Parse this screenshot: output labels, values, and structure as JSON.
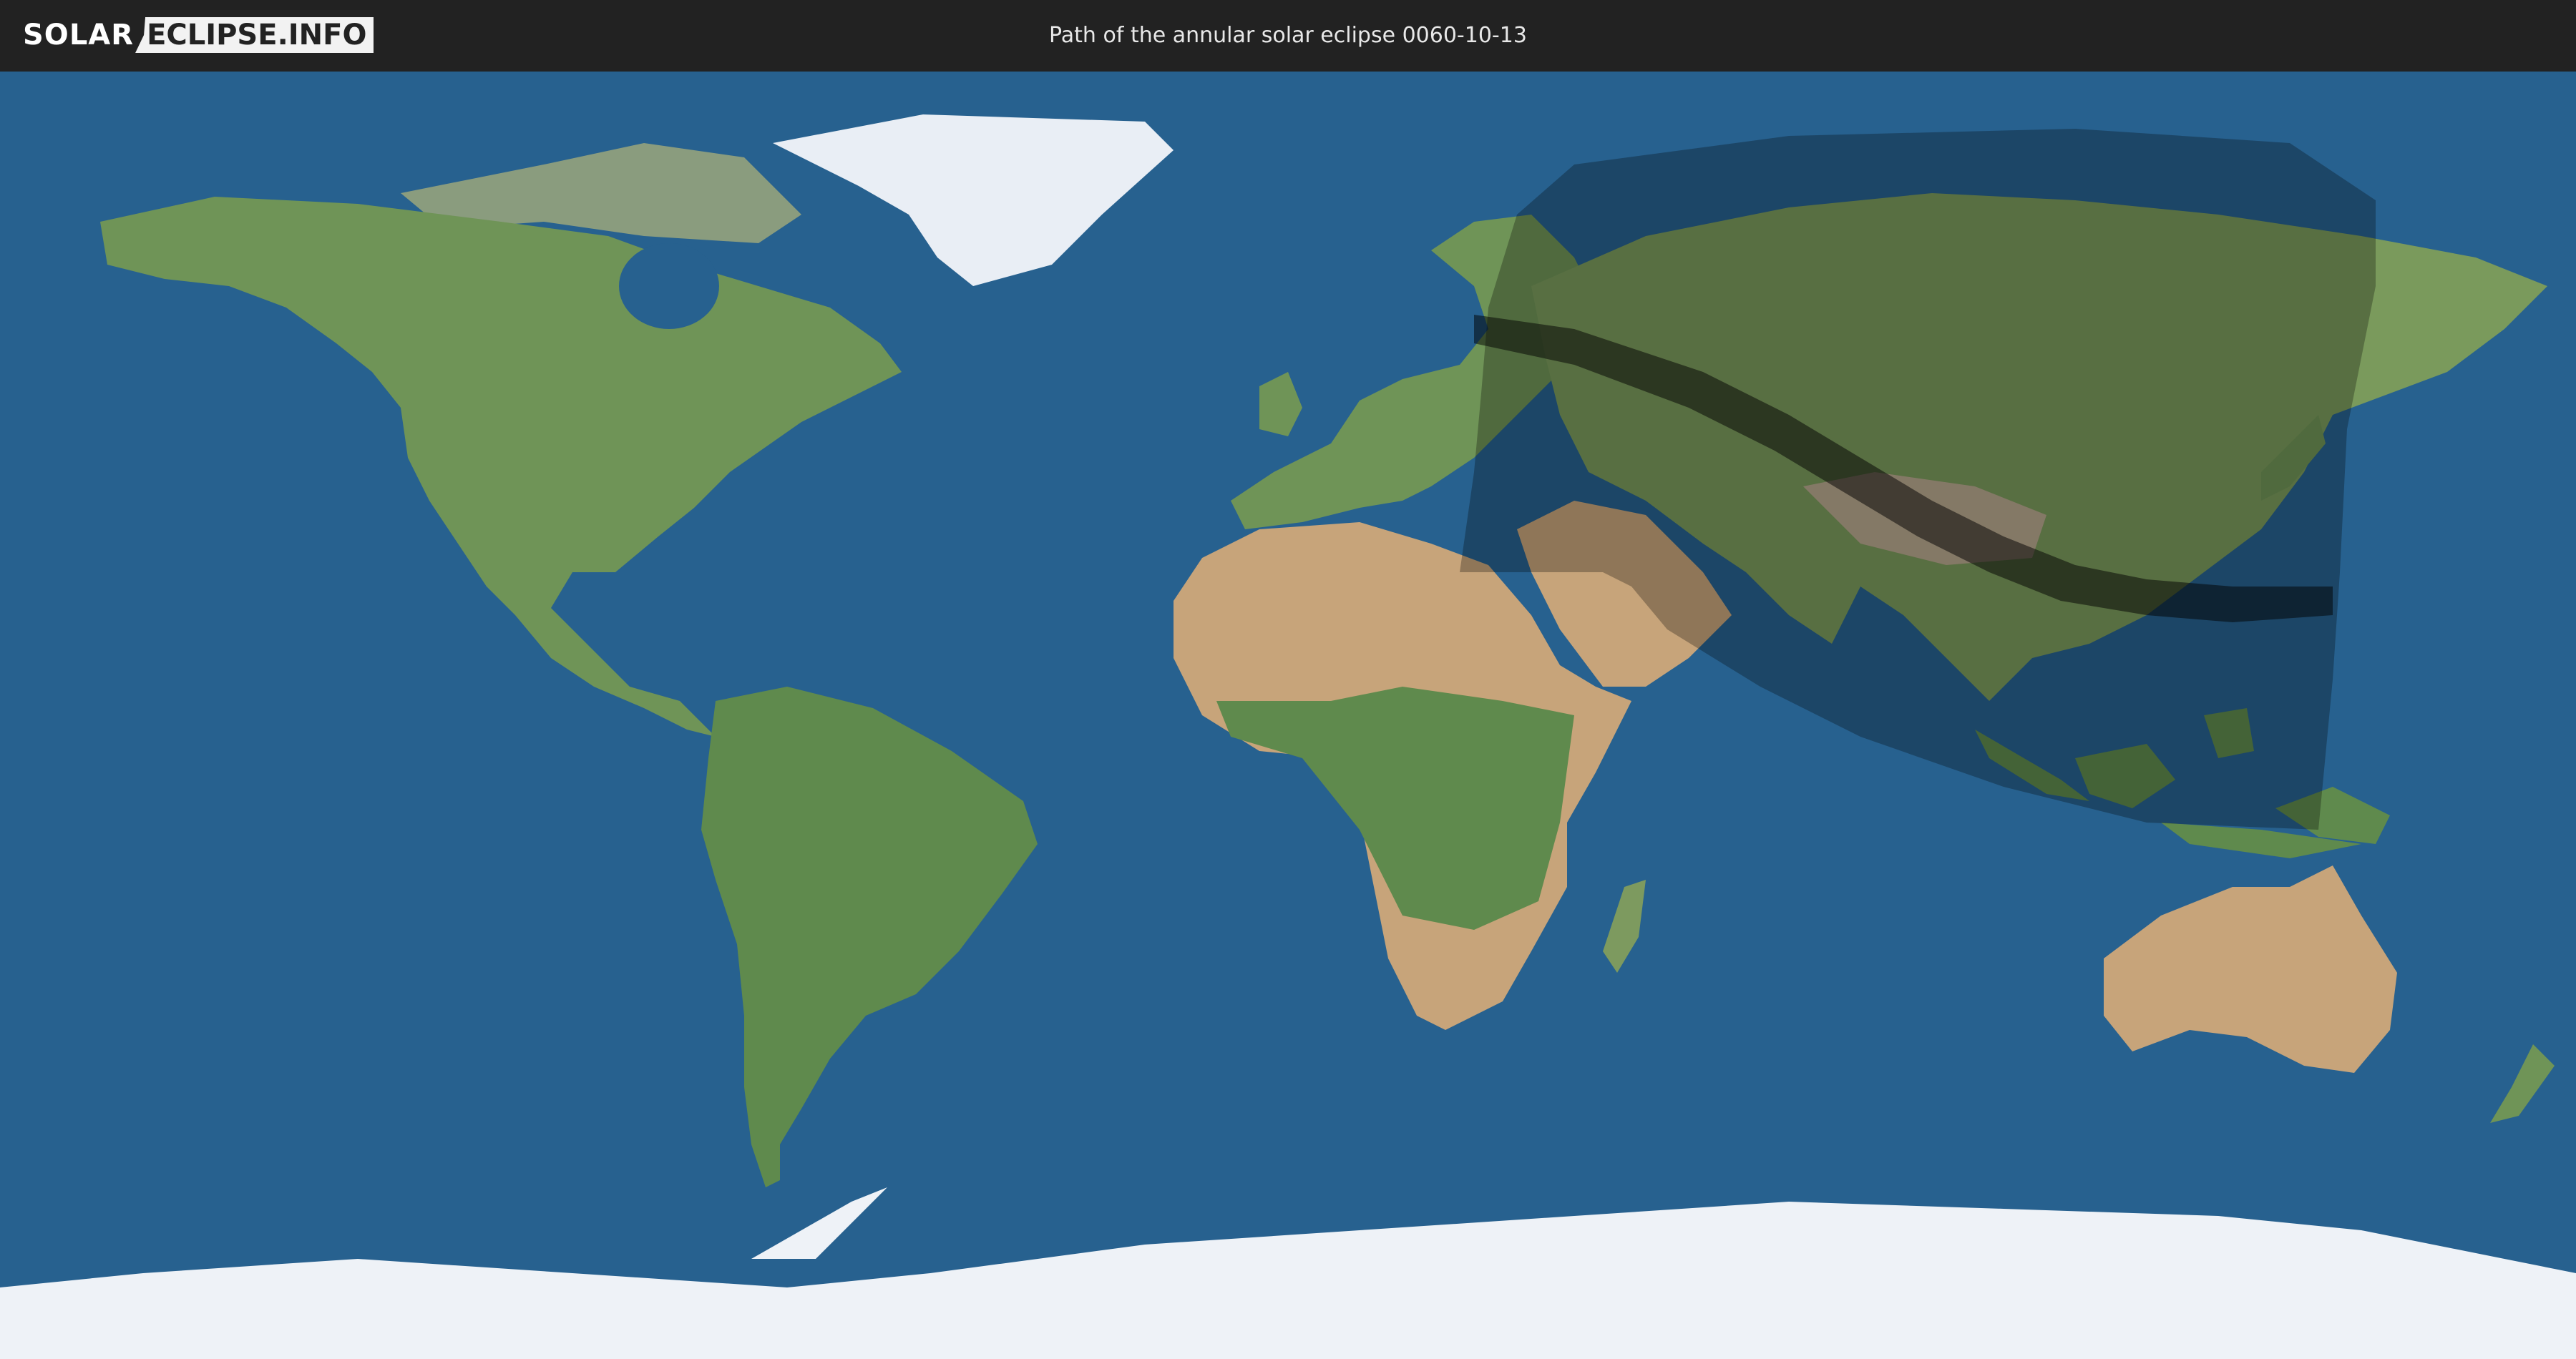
{
  "header": {
    "logo_part1": "SOLAR",
    "logo_part2": "ECLIPSE.INFO",
    "title": "Path of the annular solar eclipse 0060-10-13"
  },
  "colors": {
    "header_bg": "#222222",
    "ocean": "#27618f",
    "land": "#6f9457",
    "desert": "#c7a47a",
    "ice": "#eef2f7",
    "penumbra_overlay": "rgba(0,0,0,0.28)",
    "annular_path": "rgba(0,0,0,0.5)"
  },
  "map": {
    "projection": "equirectangular",
    "eclipse_type": "annular"
  }
}
